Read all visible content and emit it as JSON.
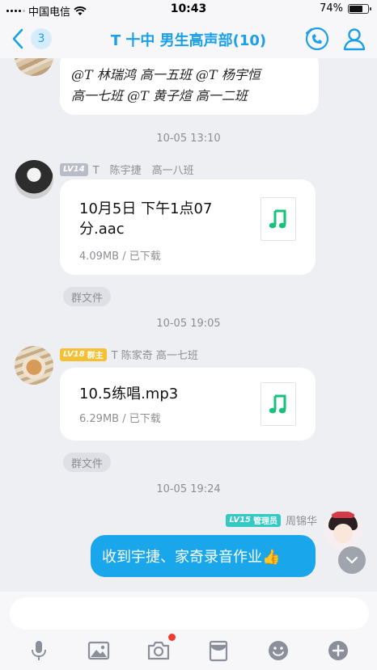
{
  "status_bar": {
    "carrier": "中国电信",
    "time": "10:43",
    "battery": "74%",
    "battery_level": 0.74
  },
  "header": {
    "back_count": "3",
    "title": "T 十中 男生高声部(10)"
  },
  "messages": {
    "prev_text_line1": "@T 林瑞鸿 高一五班 @T 杨宇恒",
    "prev_text_line2": "高一七班 @T 黄子煊 高一二班",
    "ts1": "10-05 13:10",
    "msg1": {
      "level": "LV14",
      "sender": "T　陈宇捷　高一八班",
      "file_name_line1": "10月5日 下午1点07",
      "file_name_line2": "分.aac",
      "file_meta": "4.09MB / 已下载",
      "tag": "群文件"
    },
    "ts2": "10-05 19:05",
    "msg2": {
      "level": "LV18",
      "role": "群主",
      "sender": "T 陈家奇 高一七班",
      "file_name": "10.5练唱.mp3",
      "file_meta": "6.29MB / 已下载",
      "tag": "群文件"
    },
    "ts3": "10-05 19:24",
    "msg3": {
      "level": "LV15",
      "role": "管理员",
      "sender": "周锦华",
      "text": "收到宇捷、家奇录音作业👍"
    }
  },
  "colors": {
    "accent": "#1aa0e8",
    "music_green": "#17c27a",
    "self_bubble": "#19a6ea"
  },
  "icons": [
    "back-chevron-icon",
    "phone-call-icon",
    "person-icon",
    "music-note-icon",
    "chevron-down-icon",
    "microphone-icon",
    "image-icon",
    "camera-icon",
    "red-packet-icon",
    "emoji-icon",
    "plus-icon"
  ]
}
